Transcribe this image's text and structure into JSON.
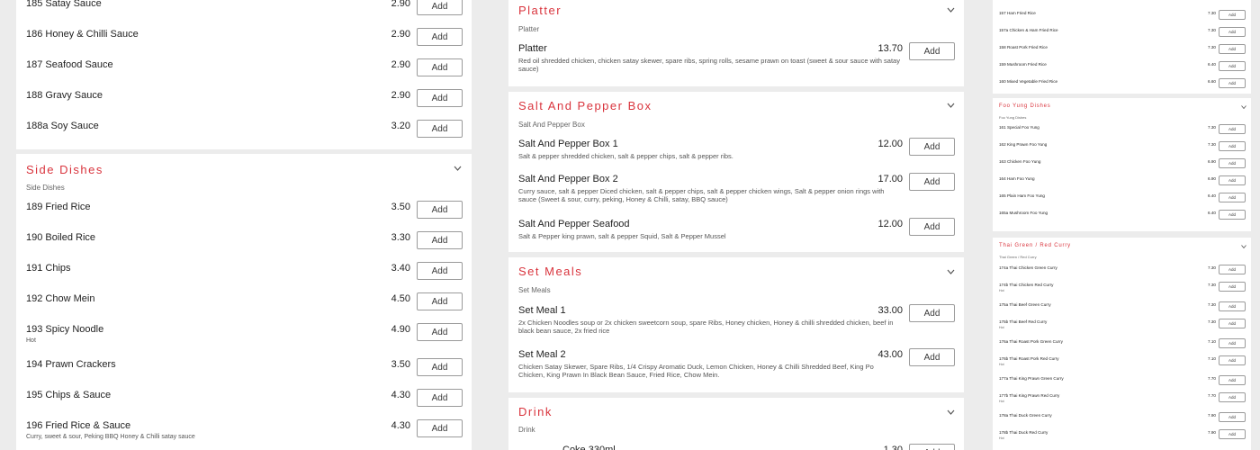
{
  "add_label": "Add",
  "colors": {
    "accent": "#d9343d",
    "background": "#ececec",
    "card": "#ffffff",
    "button_border": "#9a9a9a"
  },
  "col1": {
    "top_items": [
      {
        "name": "185 Satay Sauce",
        "price": "2.90"
      },
      {
        "name": "186 Honey & Chilli Sauce",
        "price": "2.90"
      },
      {
        "name": "187 Seafood Sauce",
        "price": "2.90"
      },
      {
        "name": "188 Gravy Sauce",
        "price": "2.90"
      },
      {
        "name": "188a Soy Sauce",
        "price": "3.20"
      }
    ],
    "side_dishes": {
      "title": "Side Dishes",
      "subtitle": "Side Dishes",
      "items": [
        {
          "name": "189 Fried Rice",
          "price": "3.50",
          "desc": ""
        },
        {
          "name": "190 Boiled Rice",
          "price": "3.30",
          "desc": ""
        },
        {
          "name": "191 Chips",
          "price": "3.40",
          "desc": ""
        },
        {
          "name": "192 Chow Mein",
          "price": "4.50",
          "desc": ""
        },
        {
          "name": "193 Spicy Noodle",
          "price": "4.90",
          "desc": "Hot"
        },
        {
          "name": "194 Prawn Crackers",
          "price": "3.50",
          "desc": ""
        },
        {
          "name": "195 Chips & Sauce",
          "price": "4.30",
          "desc": ""
        },
        {
          "name": "196 Fried Rice & Sauce",
          "price": "4.30",
          "desc": "Curry, sweet & sour, Peking BBQ Honey & Chilli satay sauce"
        }
      ]
    }
  },
  "col2": {
    "platter": {
      "title": "Platter",
      "subtitle": "Platter",
      "items": [
        {
          "name": "Platter",
          "price": "13.70",
          "desc1": "Red oil shredded chicken, chicken satay skewer, spare ribs, spring rolls, sesame prawn on toast (sweet & sour sauce with satay",
          "desc2": "sauce)"
        }
      ]
    },
    "salt_pepper": {
      "title": "Salt And Pepper Box",
      "subtitle": "Salt And Pepper Box",
      "items": [
        {
          "name": "Salt And Pepper Box 1",
          "price": "12.00",
          "desc1": "Salt & pepper shredded chicken, salt & pepper chips, salt & pepper ribs.",
          "desc2": ""
        },
        {
          "name": "Salt And Pepper Box 2",
          "price": "17.00",
          "desc1": "Curry sauce, salt & pepper Diced chicken, salt & pepper chips, salt & pepper chicken wings, Salt & pepper onion rings with",
          "desc2": "sauce (Sweet & sour, curry, peking, Honey & Chilli, satay, BBQ sauce)"
        },
        {
          "name": "Salt And Pepper Seafood",
          "price": "12.00",
          "desc1": "Salt & Pepper king prawn, salt & pepper Squid, Salt & Pepper Mussel",
          "desc2": ""
        }
      ]
    },
    "set_meals": {
      "title": "Set Meals",
      "subtitle": "Set Meals",
      "items": [
        {
          "name": "Set Meal 1",
          "price": "33.00",
          "desc1": "2x Chicken Noodles soup or 2x chicken sweetcorn soup, spare Ribs, Honey chicken, Honey & chilli shredded chicken, beef in",
          "desc2": "black bean sauce, 2x fried rice"
        },
        {
          "name": "Set Meal 2",
          "price": "43.00",
          "desc1": "Chicken Satay Skewer, Spare Ribs, 1/4 Crispy Aromatic Duck, Lemon Chicken, Honey & Chilli Shredded Beef, King Po",
          "desc2": "Chicken, King Prawn In Black Bean Sauce, Fried Rice, Chow Mein."
        }
      ]
    },
    "drink": {
      "title": "Drink",
      "subtitle": "Drink",
      "items": [
        {
          "name": "Coke 330ml",
          "price": "1.30"
        }
      ]
    }
  },
  "col3": {
    "top_items": [
      {
        "name": "157 Ham Fried Rice",
        "price": "7.30",
        "desc": ""
      },
      {
        "name": "157a Chicken & Ham Fried Rice",
        "price": "7.30",
        "desc": ""
      },
      {
        "name": "158 Roast Pork Fried Rice",
        "price": "7.30",
        "desc": ""
      },
      {
        "name": "159 Mushroom Fried Rice",
        "price": "6.40",
        "desc": ""
      },
      {
        "name": "160 Mixed Vegetable Fried Rice",
        "price": "6.60",
        "desc": ""
      }
    ],
    "foo_yung": {
      "title": "Foo Yung Dishes",
      "subtitle": "Foo Yung Dishes",
      "items": [
        {
          "name": "161 Special Foo Yung",
          "price": "7.30",
          "desc": ""
        },
        {
          "name": "162 King Prawn Foo Yung",
          "price": "7.30",
          "desc": ""
        },
        {
          "name": "163 Chicken Foo Yung",
          "price": "6.90",
          "desc": ""
        },
        {
          "name": "164 Ham Foo Yung",
          "price": "6.90",
          "desc": ""
        },
        {
          "name": "165 Plain Ham Foo Yung",
          "price": "6.40",
          "desc": ""
        },
        {
          "name": "165a Mushroom Foo Yung",
          "price": "6.40",
          "desc": ""
        }
      ]
    },
    "thai": {
      "title": "Thai Green / Red Curry",
      "subtitle": "Thai Green / Red Curry",
      "items": [
        {
          "name": "174a Thai Chicken Green Curry",
          "price": "7.30",
          "desc": ""
        },
        {
          "name": "174b Thai Chicken Red Curry",
          "price": "7.30",
          "desc": "Hot"
        },
        {
          "name": "175a Thai Beef Green Curry",
          "price": "7.30",
          "desc": ""
        },
        {
          "name": "175b Thai Beef Red Curry",
          "price": "7.30",
          "desc": "Hot"
        },
        {
          "name": "176a Thai Roast Pork Green Curry",
          "price": "7.10",
          "desc": ""
        },
        {
          "name": "176b Thai Roast Pork Red Curry",
          "price": "7.10",
          "desc": "Hot"
        },
        {
          "name": "177a Thai King Prawn Green Curry",
          "price": "7.70",
          "desc": ""
        },
        {
          "name": "177b Thai King Prawn Red Curry",
          "price": "7.70",
          "desc": "Hot"
        },
        {
          "name": "178a Thai Duck Green Curry",
          "price": "7.90",
          "desc": ""
        },
        {
          "name": "178b Thai Duck Red Curry",
          "price": "7.90",
          "desc": "Hot"
        }
      ]
    }
  }
}
